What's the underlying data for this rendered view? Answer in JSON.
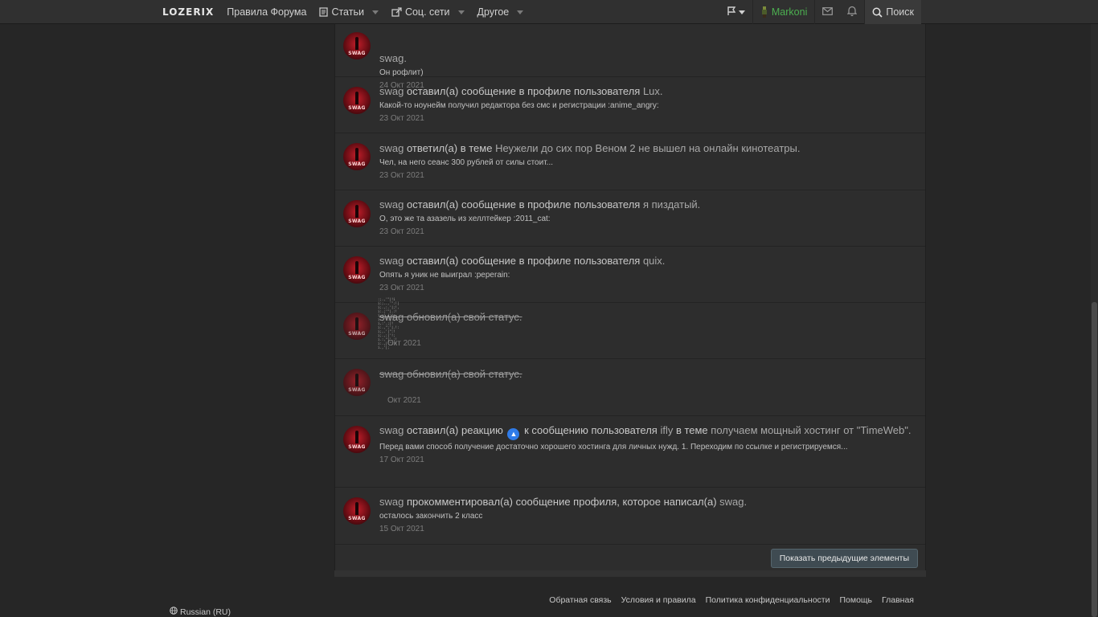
{
  "nav": {
    "logo": "LOZERIX",
    "items": [
      {
        "label": "Правила Форума",
        "icon": "",
        "dropdown": false
      },
      {
        "label": "Статьи",
        "icon": "document-icon",
        "dropdown": true
      },
      {
        "label": "Соц. сети",
        "icon": "share-icon",
        "dropdown": true
      },
      {
        "label": "Другое",
        "icon": "",
        "dropdown": true
      }
    ],
    "user": "Markoni",
    "search_label": "Поиск",
    "icons": [
      "flag-icon",
      "user-avatar-icon",
      "mail-icon",
      "bell-icon",
      "search-icon"
    ]
  },
  "feed": {
    "items": [
      {
        "user": "",
        "action": "",
        "target": "swag.",
        "snippet": "Он рофлит)",
        "date": "24 Окт 2021"
      },
      {
        "user": "swag",
        "action": " оставил(а) сообщение в профиле пользователя ",
        "target": "Lux.",
        "snippet": "Какой-то ноунейм получил редактора без смс и регистрации :anime_angry:",
        "date": "23 Окт 2021"
      },
      {
        "user": "swag",
        "action": " ответил(а) в теме ",
        "target": "Неужели до сих пор Веном 2 не вышел на онлайн кинотеатры.",
        "snippet": "Чел, на него сеанс 300 рублей от силы стоит...",
        "date": "23 Окт 2021"
      },
      {
        "user": "swag",
        "action": " оставил(а) сообщение в профиле пользователя ",
        "target": "я пиздатый.",
        "snippet": "О, это же та азазель из хеллтейкер :2011_cat:",
        "date": "23 Окт 2021"
      },
      {
        "user": "swag",
        "action": " оставил(а) сообщение в профиле пользователя ",
        "target": "quix.",
        "snippet": "Опять я уник не выиграл :peperain:",
        "date": "23 Окт 2021"
      },
      {
        "user": "swag",
        "action": " обновил(а) свой ",
        "target": "статус.",
        "snippet": "",
        "date": "Окт 2021"
      },
      {
        "user": "swag",
        "action": " обновил(а) свой ",
        "target": "статус.",
        "snippet": "",
        "date": "Окт 2021"
      },
      {
        "user": "swag",
        "action": " оставил(а) реакцию ",
        "action2": " к сообщению пользователя ",
        "target_user": "ifly",
        "action3": " в теме ",
        "target": "получаем мощный хостинг от \"TimeWeb\".",
        "snippet": "Перед вами способ получение достаточно хорошего хостинга для личных нужд. 1. Переходим по ссылке и регистрируемся...",
        "date": "17 Окт 2021"
      },
      {
        "user": "swag",
        "action": " прокомментировал(а) сообщение профиля, которое написал(а) ",
        "target": "swag.",
        "snippet": "осталось закончить 2 класс",
        "date": "15 Окт 2021"
      }
    ],
    "avatar_text": "SWAG",
    "more_button": "Показать предыдущие элементы"
  },
  "footer": {
    "links": [
      "Обратная связь",
      "Условия и правила",
      "Политика конфиденциальности",
      "Помощь",
      "Главная"
    ],
    "language": "Russian (RU)"
  }
}
